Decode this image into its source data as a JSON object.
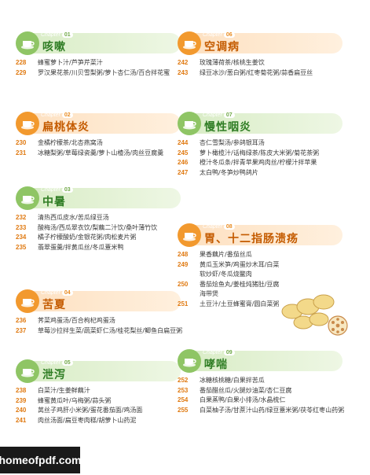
{
  "chapter_word": "Chapter",
  "left": [
    {
      "num": "01",
      "title": "咳嗽",
      "theme": "green",
      "entries": [
        {
          "page": "228",
          "text": "蜂蜜萝卜汁/芦笋芹菜汁"
        },
        {
          "page": "229",
          "text": "罗汉果花茶/川贝雪梨粥/萝卜杏仁汤/百合拌花蜜"
        }
      ]
    },
    {
      "num": "02",
      "title": "扁桃体炎",
      "theme": "orange",
      "entries": [
        {
          "page": "230",
          "text": "金橘柠檬茶/北杏燕窝汤"
        },
        {
          "page": "231",
          "text": "冰糖梨粥/草莓绿瓷羹/萝卜山楂汤/肉丝豆腐羹"
        }
      ]
    },
    {
      "num": "03",
      "title": "中暑",
      "theme": "green",
      "entries": [
        {
          "page": "232",
          "text": "清热西瓜皮水/苦瓜绿豆汤"
        },
        {
          "page": "233",
          "text": "酸梅汤/西瓜翠衣饮/梨藕二汁饮/桑叶薄竹饮"
        },
        {
          "page": "234",
          "text": "橘子柠檬酸奶/金银花粥/肉松麦片粥"
        },
        {
          "page": "235",
          "text": "翡翠蛋羹/拌黄瓜丝/冬瓜薏米鸭"
        }
      ]
    },
    {
      "num": "04",
      "title": "苦夏",
      "theme": "orange",
      "entries": [
        {
          "page": "236",
          "text": "荠菜鸡蛋汤/百合枸杞鸡蛋汤"
        },
        {
          "page": "237",
          "text": "草莓沙拉拌生菜/蔬菜虾仁汤/桂花梨丝/鲫鱼白扁豆粥"
        }
      ]
    },
    {
      "num": "05",
      "title": "泄泻",
      "theme": "green",
      "entries": [
        {
          "page": "238",
          "text": "白菜汁/生姜鲜藕汁"
        },
        {
          "page": "239",
          "text": "蜂蜜黄瓜叶/乌梅粥/蒜头粥"
        },
        {
          "page": "240",
          "text": "莴丝子鸡肝小米粥/蛋花番茄面/鸡汤面"
        },
        {
          "page": "241",
          "text": "肉丝汤面/扁豆枣肉糕/胡萝卜山药泥"
        }
      ]
    }
  ],
  "right": [
    {
      "num": "06",
      "title": "空调病",
      "theme": "orange",
      "entries": [
        {
          "page": "242",
          "text": "玫瑰薄荷茶/核桃生姜饮"
        },
        {
          "page": "243",
          "text": "绿豆冰沙/葱白粥/红枣菊花粥/蒜香扁豆丝"
        }
      ]
    },
    {
      "num": "07",
      "title": "慢性咽炎",
      "theme": "green",
      "entries": [
        {
          "page": "244",
          "text": "杏仁雪梨汤/参鸽银耳汤"
        },
        {
          "page": "245",
          "text": "萝卜橄榄汁/话梅绿茶/陈皮大米粥/菊花茶粥"
        },
        {
          "page": "246",
          "text": "橙汁冬瓜条/拌青苹果鸡肉丝/柠檬汁拌苹果"
        },
        {
          "page": "247",
          "text": "太白鸭/冬笋炒鸭鸽片"
        }
      ]
    },
    {
      "num": "08",
      "title": "胃、十二指肠溃疡",
      "theme": "orange",
      "entries": [
        {
          "page": "248",
          "text": "果香藕片/番茄丝瓜"
        },
        {
          "page": "249",
          "text": "黄瓜玉米笋/鸡蛋炒木耳/白菜软炒虾/冬瓜烧鳖肉"
        },
        {
          "page": "250",
          "text": "番茄烩鱼丸/姜桂炖猪肚/豆腐海带煲"
        },
        {
          "page": "251",
          "text": "土豆汁/土豆蜂蜜膏/圆白菜粥"
        }
      ]
    },
    {
      "num": "09",
      "title": "哮喘",
      "theme": "green",
      "entries": [
        {
          "page": "252",
          "text": "冰糖核桃糖/白果拌苦瓜"
        },
        {
          "page": "253",
          "text": "番茄醋丝瓜/火腿炒油菜/杏仁豆腐"
        },
        {
          "page": "254",
          "text": "白果蒸鸭/白果小排汤/水晶梳仁"
        },
        {
          "page": "255",
          "text": "白菜柚子汤/甘蔗汁山药/绿豆薏米粥/茯苓红枣山药粥"
        }
      ]
    }
  ],
  "watermark": "homeofpdf.com"
}
